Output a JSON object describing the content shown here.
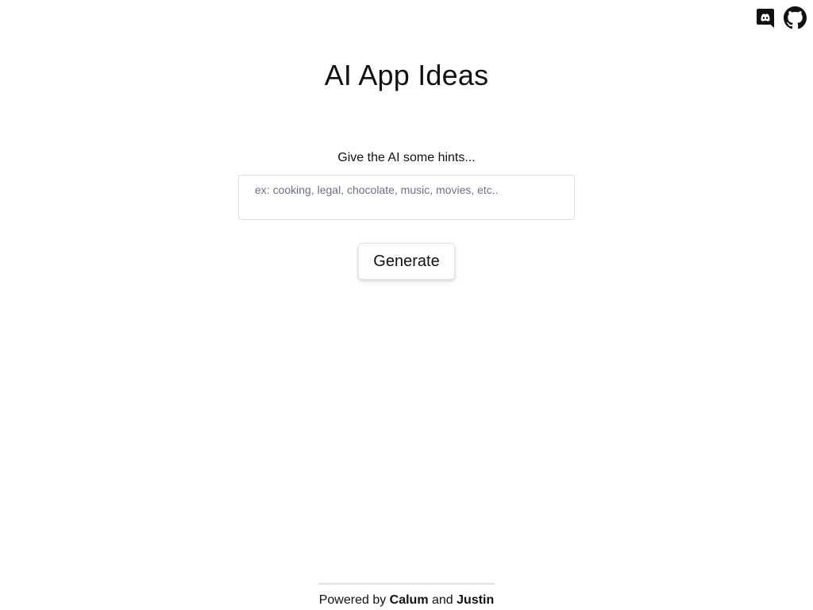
{
  "header": {
    "icons": [
      {
        "name": "discord-icon",
        "label": "Discord"
      },
      {
        "name": "github-icon",
        "label": "GitHub"
      }
    ]
  },
  "main": {
    "title": "AI App Ideas",
    "hint_label": "Give the AI some hints...",
    "hint_placeholder": "ex: cooking, legal, chocolate, music, movies, etc..",
    "hint_value": "",
    "generate_label": "Generate"
  },
  "footer": {
    "prefix": "Powered by ",
    "author_1": "Calum",
    "joiner": " and ",
    "author_2": "Justin"
  },
  "colors": {
    "background": "#ffffff",
    "text": "#111111",
    "placeholder": "#6b7280",
    "border": "#e2e2e2"
  }
}
